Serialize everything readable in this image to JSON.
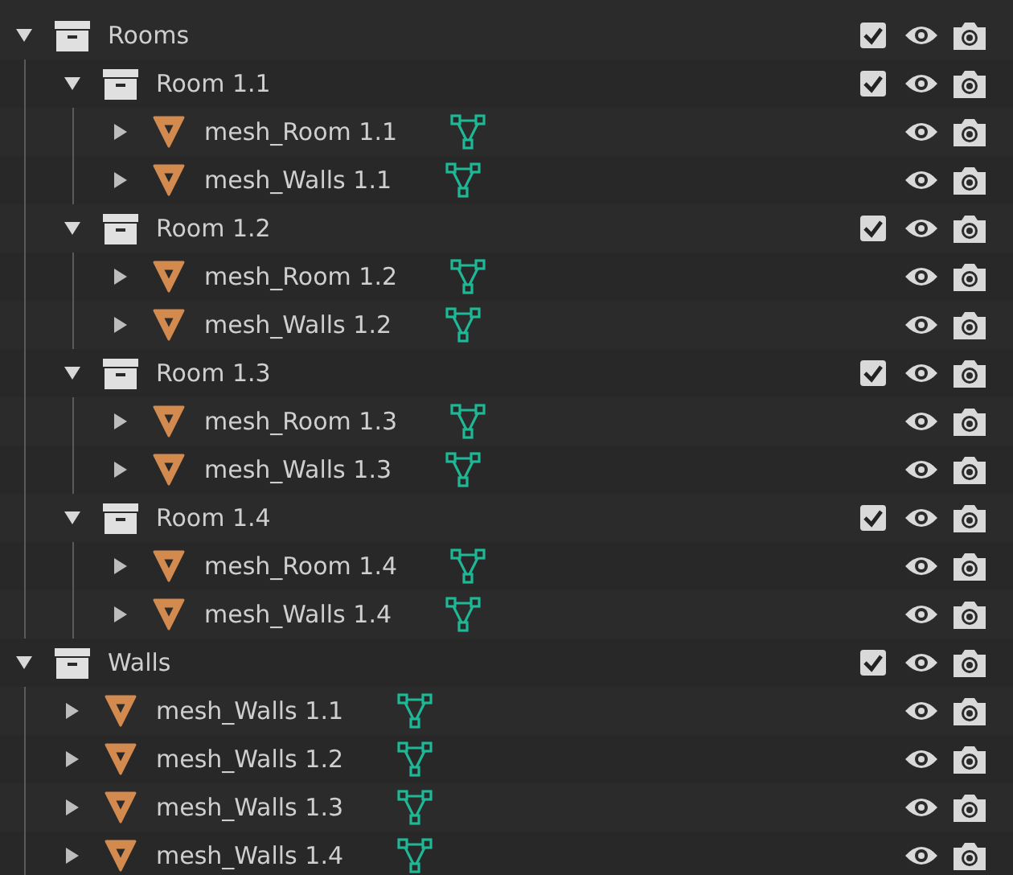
{
  "tree": [
    {
      "kind": "collection",
      "name": "Rooms",
      "expanded": true,
      "checked": true,
      "children": [
        {
          "kind": "collection",
          "name": "Room 1.1",
          "expanded": true,
          "checked": true,
          "children": [
            {
              "kind": "object",
              "name": "mesh_Room 1.1",
              "expanded": false
            },
            {
              "kind": "object",
              "name": "mesh_Walls 1.1",
              "expanded": false
            }
          ]
        },
        {
          "kind": "collection",
          "name": "Room 1.2",
          "expanded": true,
          "checked": true,
          "children": [
            {
              "kind": "object",
              "name": "mesh_Room 1.2",
              "expanded": false
            },
            {
              "kind": "object",
              "name": "mesh_Walls 1.2",
              "expanded": false
            }
          ]
        },
        {
          "kind": "collection",
          "name": "Room 1.3",
          "expanded": true,
          "checked": true,
          "children": [
            {
              "kind": "object",
              "name": "mesh_Room 1.3",
              "expanded": false
            },
            {
              "kind": "object",
              "name": "mesh_Walls 1.3",
              "expanded": false
            }
          ]
        },
        {
          "kind": "collection",
          "name": "Room 1.4",
          "expanded": true,
          "checked": true,
          "children": [
            {
              "kind": "object",
              "name": "mesh_Room 1.4",
              "expanded": false
            },
            {
              "kind": "object",
              "name": "mesh_Walls 1.4",
              "expanded": false
            }
          ]
        }
      ]
    },
    {
      "kind": "collection",
      "name": "Walls",
      "expanded": true,
      "checked": true,
      "children": [
        {
          "kind": "object",
          "name": "mesh_Walls 1.1",
          "expanded": false
        },
        {
          "kind": "object",
          "name": "mesh_Walls 1.2",
          "expanded": false
        },
        {
          "kind": "object",
          "name": "mesh_Walls 1.3",
          "expanded": false
        },
        {
          "kind": "object",
          "name": "mesh_Walls 1.4",
          "expanded": false
        }
      ]
    }
  ]
}
